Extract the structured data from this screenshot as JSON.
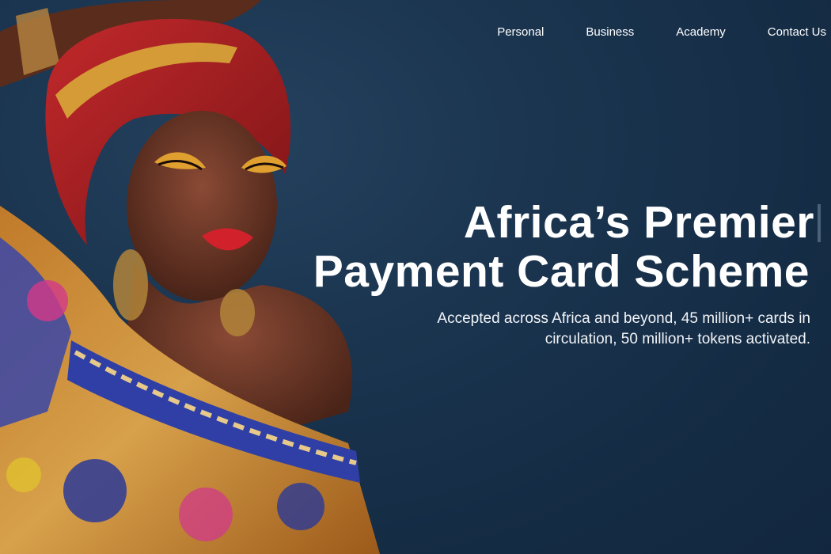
{
  "nav": {
    "items": [
      {
        "label": "Personal"
      },
      {
        "label": "Business"
      },
      {
        "label": "Academy"
      },
      {
        "label": "Contact Us"
      }
    ]
  },
  "hero": {
    "headline_line1": "Africa’s Premier",
    "headline_line2": "Payment Card Scheme",
    "subtitle": "Accepted across Africa and beyond, 45 million+ cards in circulation, 50 million+ tokens activated."
  },
  "colors": {
    "background": "#152c45",
    "text": "#ffffff",
    "cursor": "#4b6079"
  }
}
